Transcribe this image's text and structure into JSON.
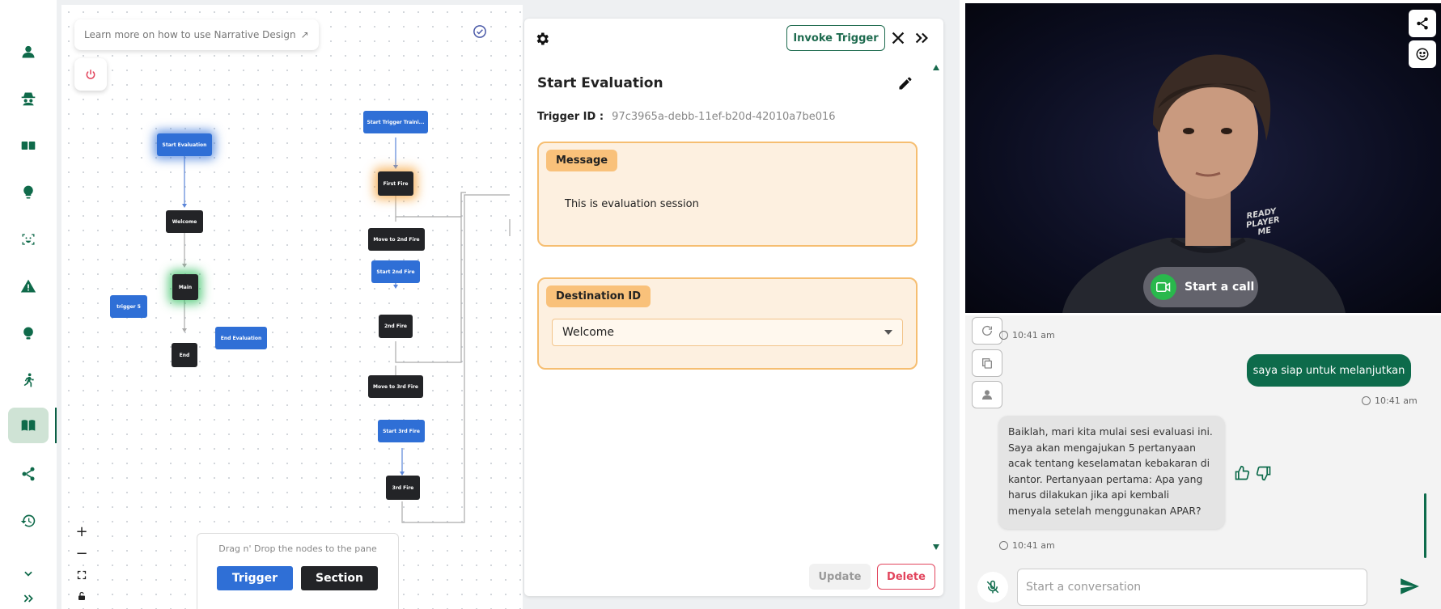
{
  "canvas": {
    "hint": "Learn more on how to use Narrative Design",
    "nodes": [
      "Start Evaluation",
      "Welcome",
      "Main",
      "End",
      "trigger 5",
      "End Evaluation",
      "Start Trigger Traini...",
      "First Fire",
      "Move to 2nd Fire",
      "Start 2nd Fire",
      "2nd Fire",
      "Move to 3rd Fire",
      "Start 3rd Fire",
      "3rd Fire"
    ],
    "zoom": {
      "plus": "+",
      "minus": "−"
    },
    "dnd": {
      "hint": "Drag n' Drop the nodes to the pane",
      "trigger_label": "Trigger",
      "section_label": "Section"
    },
    "colors": {
      "trigger_node": "#2f6fd6",
      "section_node": "#232427"
    }
  },
  "panel": {
    "invoke_label": "Invoke Trigger",
    "title": "Start Evaluation",
    "trigger_id_label": "Trigger ID :",
    "trigger_id_value": "97c3965a-debb-11ef-b20d-42010a7be016",
    "message_label": "Message",
    "message_text": "This is evaluation session",
    "destination_label": "Destination ID",
    "destination_value": "Welcome",
    "update_label": "Update",
    "delete_label": "Delete"
  },
  "avatar": {
    "call_label": "Start a call",
    "shirt_text": "READY PLAYER ME"
  },
  "chat": {
    "ts1": "10:41 am",
    "user_msg": "saya siap untuk melanjutkan",
    "ts2": "10:41 am",
    "bot_msg": "Baiklah, mari kita mulai sesi evaluasi ini. Saya akan mengajukan 5 pertanyaan acak tentang keselamatan kebakaran di kantor. Pertanyaan pertama: Apa yang harus dilakukan jika api kembali menyala setelah menggunakan APAR?",
    "ts3": "10:41 am",
    "input_placeholder": "Start a conversation"
  }
}
